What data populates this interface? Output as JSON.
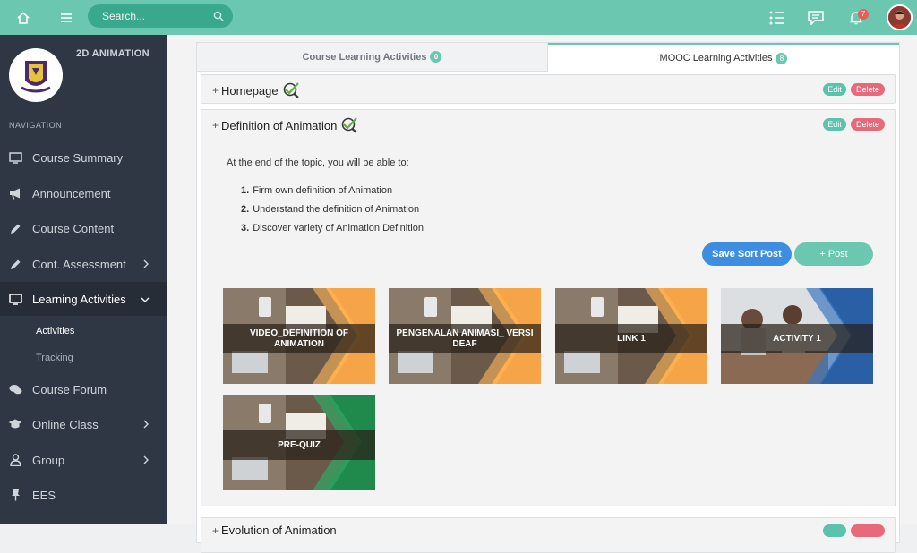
{
  "topbar": {
    "search_placeholder": "Search...",
    "notification_count": "7",
    "accent": "#6cc7b0"
  },
  "sidebar": {
    "course_name": "2D ANIMATION",
    "nav_title": "NAVIGATION",
    "items": [
      {
        "label": "Course Summary",
        "icon": "monitor-icon"
      },
      {
        "label": "Announcement",
        "icon": "megaphone-icon"
      },
      {
        "label": "Course Content",
        "icon": "pencil-icon"
      },
      {
        "label": "Cont. Assessment",
        "icon": "pencil-icon"
      },
      {
        "label": "Learning Activities",
        "icon": "monitor-icon"
      },
      {
        "label": "Course Forum",
        "icon": "chat-icon"
      },
      {
        "label": "Online Class",
        "icon": "graduation-cap-icon"
      },
      {
        "label": "Group",
        "icon": "user-icon"
      },
      {
        "label": "EES",
        "icon": "pin-icon"
      }
    ],
    "sub_items": [
      {
        "label": "Activities"
      },
      {
        "label": "Tracking"
      }
    ]
  },
  "tabs": [
    {
      "label": "Course Learning Activities",
      "count": "0"
    },
    {
      "label": "MOOC Learning Activities",
      "count": "8"
    }
  ],
  "topics": [
    {
      "title": "Homepage",
      "edit": "Edit",
      "delete": "Delete"
    },
    {
      "title": "Definition of Animation",
      "edit": "Edit",
      "delete": "Delete",
      "intro": "At the end of the topic, you will be able to:",
      "objectives": [
        {
          "num": "1.",
          "text": "Firm own definition of Animation"
        },
        {
          "num": "2.",
          "text": "Understand the definition of Animation"
        },
        {
          "num": "3.",
          "text": "Discover variety of Animation Definition"
        }
      ],
      "save_sort": "Save Sort Post",
      "post": "+ Post",
      "cards": [
        {
          "title": "VIDEO_DEFINITION OF ANIMATION",
          "accent": "#f5a547"
        },
        {
          "title": "PENGENALAN ANIMASI_ VERSI DEAF",
          "accent": "#f5a547"
        },
        {
          "title": "LINK 1",
          "accent": "#f5a547"
        },
        {
          "title": "ACTIVITY 1",
          "accent": "#2a5fa6"
        },
        {
          "title": "PRE-QUIZ",
          "accent": "#1f8a4c"
        }
      ]
    },
    {
      "title": "Evolution of Animation"
    }
  ]
}
